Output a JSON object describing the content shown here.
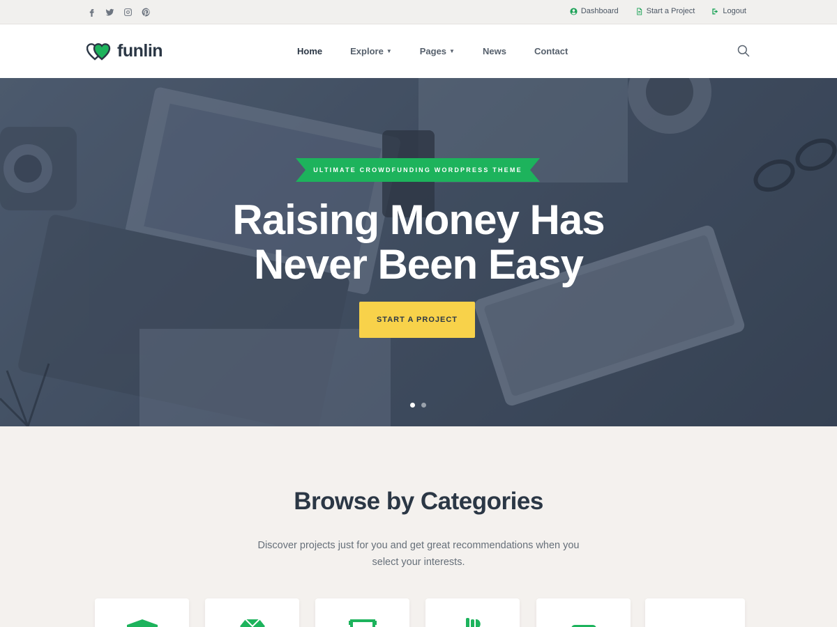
{
  "topbar": {
    "social": [
      {
        "icon": "facebook-icon"
      },
      {
        "icon": "twitter-icon"
      },
      {
        "icon": "instagram-icon"
      },
      {
        "icon": "pinterest-icon"
      }
    ],
    "links": [
      {
        "label": "Dashboard",
        "icon": "user-circle-icon"
      },
      {
        "label": "Start a Project",
        "icon": "document-icon"
      },
      {
        "label": "Logout",
        "icon": "sign-out-icon"
      }
    ]
  },
  "header": {
    "logo_text": "funlin",
    "nav": [
      {
        "label": "Home",
        "active": true,
        "dropdown": false
      },
      {
        "label": "Explore",
        "active": false,
        "dropdown": true
      },
      {
        "label": "Pages",
        "active": false,
        "dropdown": true
      },
      {
        "label": "News",
        "active": false,
        "dropdown": false
      },
      {
        "label": "Contact",
        "active": false,
        "dropdown": false
      }
    ],
    "search_icon": "search-icon"
  },
  "hero": {
    "ribbon": "ULTIMATE CROWDFUNDING WORDPRESS THEME",
    "title_line1": "Raising Money Has",
    "title_line2": "Never Been Easy",
    "cta": "START A PROJECT",
    "slides": 2,
    "active_slide": 1
  },
  "categories": {
    "title": "Browse by Categories",
    "subtitle": "Discover projects just for you and get great recommendations when you select your interests.",
    "cards": [
      {
        "icon": "building-icon"
      },
      {
        "icon": "diamond-icon"
      },
      {
        "icon": "film-icon"
      },
      {
        "icon": "food-icon"
      },
      {
        "icon": "tech-icon"
      },
      {
        "icon": "heart-icon"
      }
    ]
  },
  "colors": {
    "accent_green": "#1db35c",
    "cta_yellow": "#f8d24a",
    "dark_text": "#2b3745",
    "page_bg": "#f4f1ee"
  }
}
